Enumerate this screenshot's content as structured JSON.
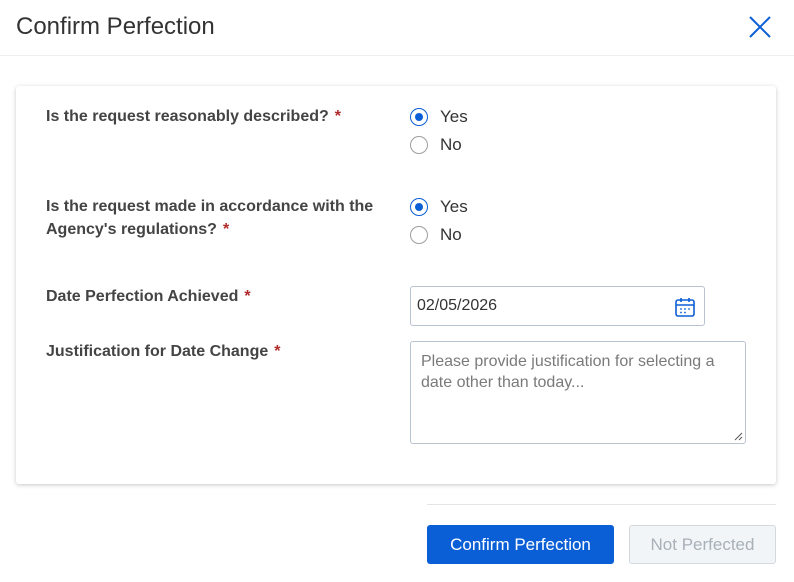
{
  "dialog": {
    "title": "Confirm Perfection"
  },
  "form": {
    "q1": {
      "label": "Is the request reasonably described?",
      "required_mark": "*",
      "options": [
        "Yes",
        "No"
      ],
      "selected": "Yes"
    },
    "q2": {
      "label_line1": "Is the request made in accordance with the",
      "label_line2": "Agency's regulations?",
      "required_mark": "*",
      "options": [
        "Yes",
        "No"
      ],
      "selected": "Yes"
    },
    "date": {
      "label": "Date Perfection Achieved",
      "required_mark": "*",
      "value": "02/05/2026",
      "icon": "calendar-icon"
    },
    "justification": {
      "label": "Justification for Date Change",
      "required_mark": "*",
      "placeholder": "Please provide justification for selecting a date other than today..."
    }
  },
  "footer": {
    "confirm_label": "Confirm Perfection",
    "not_perfected_label": "Not Perfected"
  },
  "colors": {
    "accent": "#0b5fd6",
    "required": "#b02a2a",
    "disabled_text": "#a8b0b8"
  }
}
